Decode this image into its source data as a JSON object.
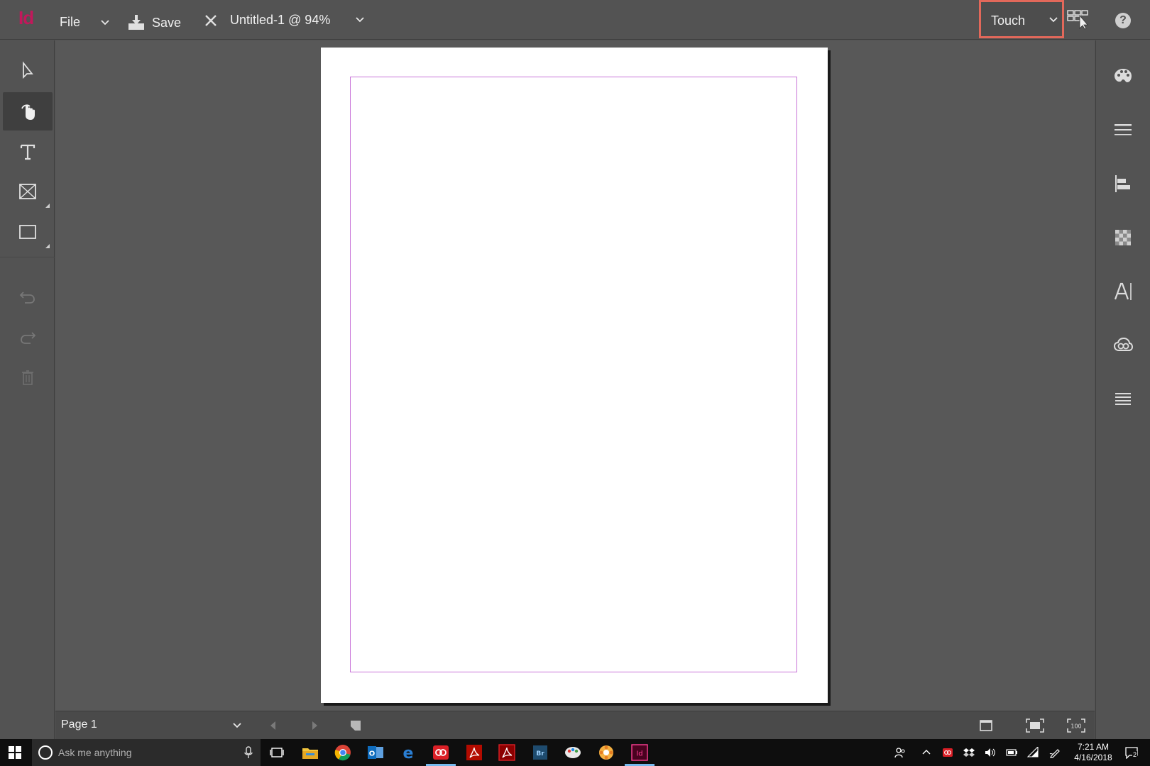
{
  "header": {
    "app_logo": "Id",
    "file_menu": "File",
    "save_label": "Save",
    "doc_title": "Untitled-1 @ 94%",
    "workspace": "Touch",
    "help_glyph": "?"
  },
  "left_tools": [
    {
      "name": "selection-tool",
      "icon": "arrow-icon"
    },
    {
      "name": "hand-tool",
      "icon": "hand-icon",
      "active": true
    },
    {
      "name": "type-tool",
      "icon": "type-icon"
    },
    {
      "name": "rectangle-frame-tool",
      "icon": "frame-icon"
    },
    {
      "name": "rectangle-tool",
      "icon": "rectangle-icon"
    },
    {
      "name": "undo",
      "icon": "undo-icon"
    },
    {
      "name": "redo",
      "icon": "redo-icon"
    },
    {
      "name": "delete",
      "icon": "trash-icon"
    }
  ],
  "right_panels": [
    {
      "name": "swatches",
      "icon": "palette-icon"
    },
    {
      "name": "stroke",
      "icon": "stroke-lines-icon"
    },
    {
      "name": "align",
      "icon": "align-icon"
    },
    {
      "name": "effects",
      "icon": "checker-icon"
    },
    {
      "name": "character",
      "icon": "character-icon"
    },
    {
      "name": "cc-libraries",
      "icon": "creative-cloud-icon"
    },
    {
      "name": "paragraph",
      "icon": "paragraph-lines-icon"
    }
  ],
  "bottom": {
    "page_label": "Page 1"
  },
  "taskbar": {
    "search_placeholder": "Ask me anything",
    "time": "7:21 AM",
    "date": "4/16/2018",
    "notification_count": "2"
  },
  "colors": {
    "indesign_pink": "#c2185b",
    "highlight": "#e2685a",
    "margin_guide": "#c873d8",
    "taskbar_active": "#76b9ed"
  }
}
